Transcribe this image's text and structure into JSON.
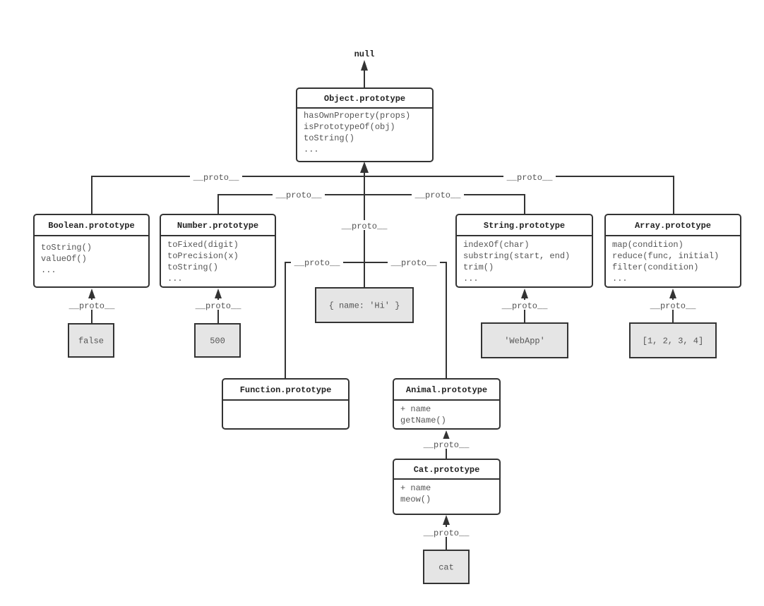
{
  "diagram": {
    "null_label": "null",
    "proto_label": "__proto__",
    "classes": [
      {
        "id": "object",
        "title": "Object.prototype",
        "members": [
          "hasOwnProperty(props)",
          "isPrototypeOf(obj)",
          "toString()",
          "..."
        ]
      },
      {
        "id": "boolean",
        "title": "Boolean.prototype",
        "members": [
          "toString()",
          "valueOf()",
          "..."
        ]
      },
      {
        "id": "number",
        "title": "Number.prototype",
        "members": [
          "toFixed(digit)",
          "toPrecision(x)",
          "toString()",
          "..."
        ]
      },
      {
        "id": "string",
        "title": "String.prototype",
        "members": [
          "indexOf(char)",
          "substring(start, end)",
          "trim()",
          "..."
        ]
      },
      {
        "id": "array",
        "title": "Array.prototype",
        "members": [
          "map(condition)",
          "reduce(func, initial)",
          "filter(condition)",
          "..."
        ]
      },
      {
        "id": "function",
        "title": "Function.prototype",
        "members": []
      },
      {
        "id": "animal",
        "title": "Animal.prototype",
        "members": [
          "+ name",
          "getName()"
        ]
      },
      {
        "id": "cat",
        "title": "Cat.prototype",
        "members": [
          "+ name",
          "meow()"
        ]
      }
    ],
    "values": [
      {
        "id": "obj-literal",
        "text": "{ name: 'Hi' }",
        "proto_of": "object"
      },
      {
        "id": "false",
        "text": "false",
        "proto_of": "boolean"
      },
      {
        "id": "500",
        "text": "500",
        "proto_of": "number"
      },
      {
        "id": "webapp",
        "text": "'WebApp'",
        "proto_of": "string"
      },
      {
        "id": "array-literal",
        "text": "[1, 2, 3, 4]",
        "proto_of": "array"
      },
      {
        "id": "cat-instance",
        "text": "cat",
        "proto_of": "cat"
      }
    ],
    "links": [
      {
        "from": "object",
        "to": "null"
      },
      {
        "from": "boolean",
        "to": "object"
      },
      {
        "from": "number",
        "to": "object"
      },
      {
        "from": "string",
        "to": "object"
      },
      {
        "from": "array",
        "to": "object"
      },
      {
        "from": "function",
        "to": "object"
      },
      {
        "from": "animal",
        "to": "object"
      },
      {
        "from": "cat",
        "to": "animal"
      }
    ]
  }
}
